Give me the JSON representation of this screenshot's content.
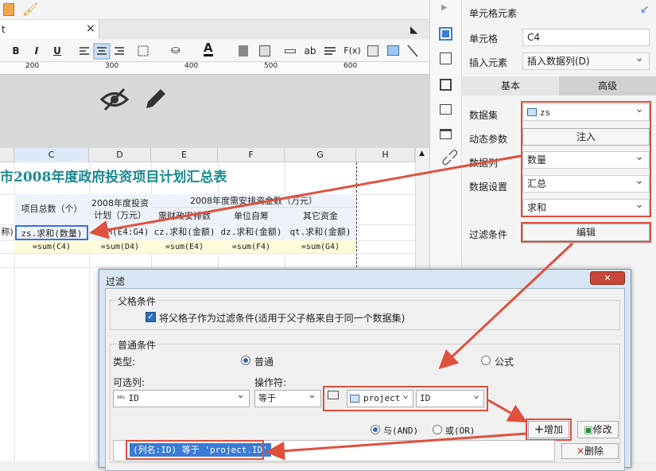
{
  "editor": {
    "tab_fragment": "t",
    "tab_close": "×",
    "format": {
      "bold": "B",
      "italic": "I",
      "underline": "U",
      "text_ab": "ab",
      "fx": "F(x)"
    },
    "ruler_ticks": [
      "200",
      "300",
      "400",
      "500",
      "600"
    ],
    "columns": [
      "C",
      "D",
      "E",
      "F",
      "G",
      "H"
    ],
    "sheet": {
      "title": "市2008年度政府投资项目计划汇总表",
      "hdr_project_total": "项目总数（个）",
      "hdr_invest_plan": "2008年度投资计划（万元）",
      "hdr_need": "2008年度需安排资金数（万元）",
      "hdr_sub1": "需财政安排数",
      "hdr_sub2": "单位自筹",
      "hdr_sub3": "其它资金",
      "row_left_stub": "称)",
      "row1": [
        "zs.求和(数量)",
        "=SUM(E4:G4)",
        "cz.求和(金额)",
        "dz.求和(金额)",
        "qt.求和(金额)"
      ],
      "row2": [
        "=sum(C4)",
        "=sum(D4)",
        "=sum(E4)",
        "=sum(F4)",
        "=sum(G4)"
      ]
    }
  },
  "panel": {
    "title": "单元格元素",
    "cell_label": "单元格",
    "cell_value": "C4",
    "insert_label": "插入元素",
    "insert_value": "插入数据列(D)",
    "tab_basic": "基本",
    "tab_advanced": "高级",
    "dataset_label": "数据集",
    "dataset_value": "zs",
    "dynparam_label": "动态参数",
    "dynparam_button": "注入",
    "datacol_label": "数据列",
    "datacol_value": "数量",
    "dataset_setting_label": "数据设置",
    "dataset_setting_value": "汇总",
    "agg_value": "求和",
    "filter_label": "过滤条件",
    "filter_button": "编辑"
  },
  "dialog": {
    "title": "过滤",
    "close": "✕",
    "parent_group": "父格条件",
    "parent_checkbox": "将父格子作为过滤条件(适用于父子格来自于同一个数据集)",
    "normal_group": "普通条件",
    "type_label": "类型:",
    "type_normal": "普通",
    "type_formula": "公式",
    "selectable_label": "可选列:",
    "selectable_value": "ID",
    "operator_label": "操作符:",
    "operator_value": "等于",
    "source_value": "project",
    "column_value": "ID",
    "and_label": "与(AND)",
    "or_label": "或(OR)",
    "add_button": "增加",
    "modify_button": "修改",
    "delete_button": "删除",
    "condition_item": "(列名:ID) 等于 'project.ID'"
  },
  "colors": {
    "accent": "#e0503c",
    "title_teal": "#1a8a8f",
    "select_blue": "#3a6fd8"
  }
}
